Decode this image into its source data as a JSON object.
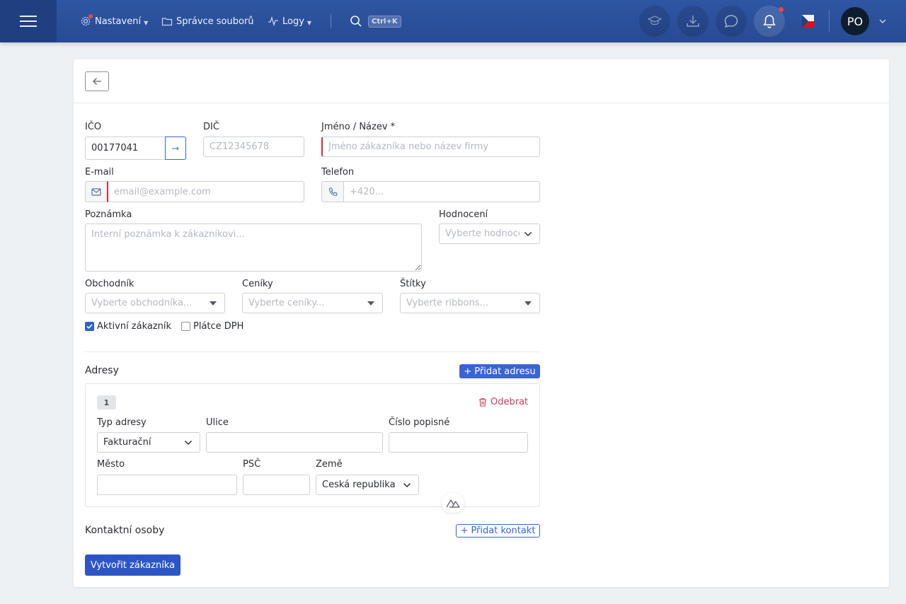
{
  "topbar": {
    "nav": [
      {
        "label": "Nastavení",
        "icon": "gear-icon",
        "has_caret": true
      },
      {
        "label": "Správce souborů",
        "icon": "folder-icon",
        "has_caret": false
      },
      {
        "label": "Logy",
        "icon": "activity-icon",
        "has_caret": true
      }
    ],
    "search_shortcut": "Ctrl+K",
    "avatar_initials": "PO",
    "colors": {
      "bar": "#2f56a3",
      "notification_dot": "#e5484d"
    }
  },
  "form": {
    "ico": {
      "label": "IČO",
      "value": "00177041"
    },
    "dic": {
      "label": "DIČ",
      "placeholder": "CZ12345678"
    },
    "name": {
      "label": "Jméno / Název *",
      "placeholder": "Jméno zákazníka nebo název firmy"
    },
    "email": {
      "label": "E-mail",
      "placeholder": "email@example.com"
    },
    "phone": {
      "label": "Telefon",
      "placeholder": "+420..."
    },
    "note": {
      "label": "Poznámka",
      "placeholder": "Interní poznámka k zákazníkovi..."
    },
    "rating": {
      "label": "Hodnocení",
      "placeholder": "Vyberte hodnocení"
    },
    "salesman": {
      "label": "Obchodník",
      "placeholder": "Vyberte obchodníka..."
    },
    "pricelists": {
      "label": "Ceníky",
      "placeholder": "Vyberte ceníky..."
    },
    "tags": {
      "label": "Štítky",
      "placeholder": "Vyberte ribbons..."
    },
    "active_customer": {
      "label": "Aktivní zákazník",
      "checked": true
    },
    "vat_payer": {
      "label": "Plátce DPH",
      "checked": false
    }
  },
  "addresses": {
    "title": "Adresy",
    "add_label": "Přidat adresu",
    "items": [
      {
        "index": "1",
        "remove_label": "Odebrat",
        "type": {
          "label": "Typ adresy",
          "value": "Fakturační"
        },
        "street": {
          "label": "Ulice",
          "value": ""
        },
        "house_number": {
          "label": "Číslo popisné",
          "value": ""
        },
        "city": {
          "label": "Město",
          "value": ""
        },
        "zip": {
          "label": "PSČ",
          "value": ""
        },
        "country": {
          "label": "Země",
          "value": "Česká republika"
        }
      }
    ]
  },
  "contacts": {
    "title": "Kontaktní osoby",
    "add_label": "Přidat kontakt"
  },
  "submit_label": "Vytvořit zákazníka",
  "colors": {
    "primary": "#3a63d8",
    "error": "#d9293a",
    "danger": "#d23b57"
  }
}
